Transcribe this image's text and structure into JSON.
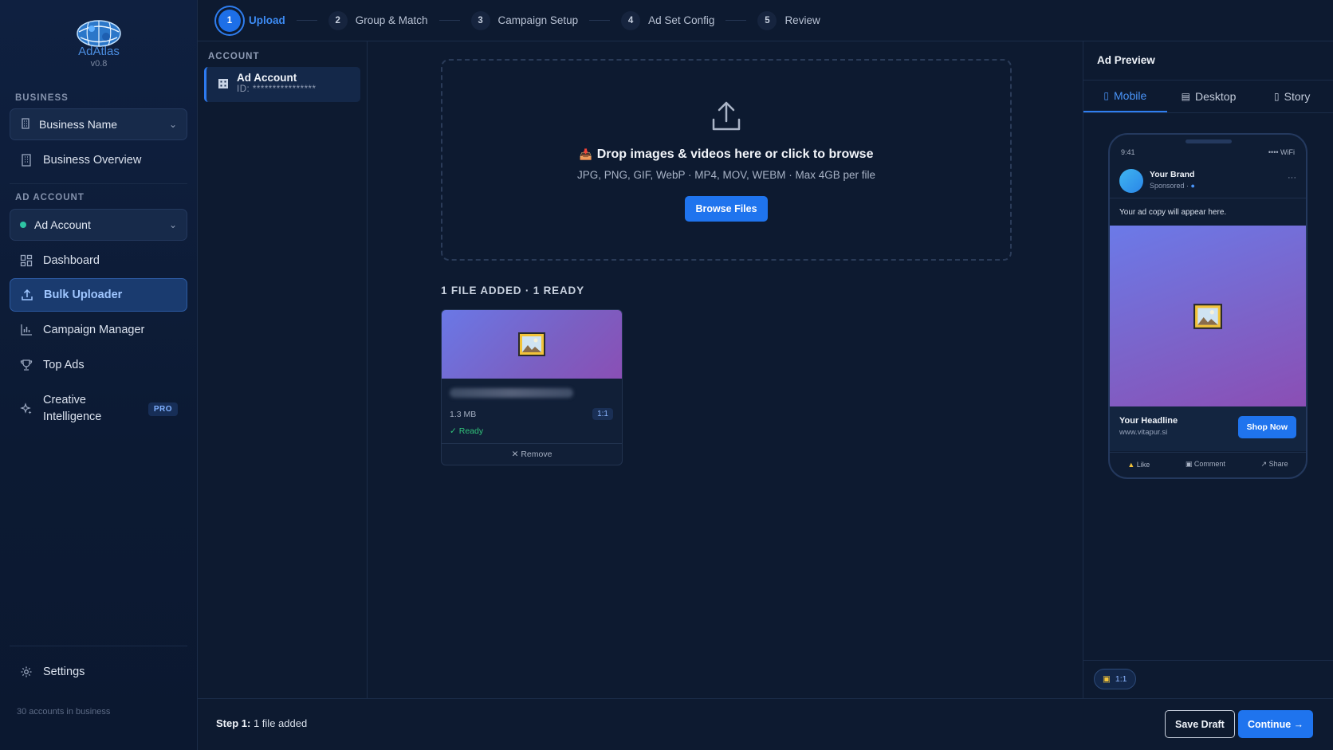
{
  "app": {
    "name": "AdAtlas",
    "version": "v0.8"
  },
  "sidebar": {
    "business_section": "BUSINESS",
    "business_select": "Business Name",
    "business_overview": "Business Overview",
    "ad_account_section": "AD ACCOUNT",
    "ad_account_select": "Ad Account",
    "nav": [
      {
        "label": "Dashboard",
        "icon": "grid-icon"
      },
      {
        "label": "Bulk Uploader",
        "icon": "upload-icon",
        "active": true
      },
      {
        "label": "Campaign Manager",
        "icon": "bar-chart-icon"
      },
      {
        "label": "Top Ads",
        "icon": "trophy-icon"
      },
      {
        "label": "Creative Intelligence",
        "icon": "sparkle-icon",
        "badge": "PRO"
      }
    ],
    "settings": "Settings",
    "footer_note": "30 accounts in business"
  },
  "stepper": [
    {
      "num": "1",
      "label": "Upload",
      "active": true
    },
    {
      "num": "2",
      "label": "Group & Match"
    },
    {
      "num": "3",
      "label": "Campaign Setup"
    },
    {
      "num": "4",
      "label": "Ad Set Config"
    },
    {
      "num": "5",
      "label": "Review"
    }
  ],
  "account_panel": {
    "heading": "ACCOUNT",
    "item_title": "Ad Account",
    "item_id": "ID: ****************"
  },
  "dropzone": {
    "title": "Drop images & videos here or click to browse",
    "subtitle": "JPG, PNG, GIF, WebP · MP4, MOV, WEBM · Max 4GB per file",
    "button": "Browse Files"
  },
  "files": {
    "heading": "1 FILE ADDED · 1 READY",
    "items": [
      {
        "size": "1.3 MB",
        "ratio": "1:1",
        "status": "Ready",
        "remove": "Remove"
      }
    ]
  },
  "preview": {
    "title": "Ad Preview",
    "tabs": [
      {
        "label": "Mobile",
        "icon": "phone-icon",
        "active": true
      },
      {
        "label": "Desktop",
        "icon": "monitor-icon"
      },
      {
        "label": "Story",
        "icon": "story-icon"
      }
    ],
    "phone": {
      "time": "9:41",
      "signal": "•••• WiFi",
      "brand": "Your Brand",
      "sponsored": "Sponsored ·",
      "more": "···",
      "copy": "Your ad copy will appear here.",
      "headline": "Your Headline",
      "url": "www.vitapur.si",
      "cta": "Shop Now",
      "actions": [
        "Like",
        "Comment",
        "Share"
      ]
    },
    "ratio": "1:1"
  },
  "footer": {
    "step_label": "Step 1:",
    "step_text": "1 file added",
    "save": "Save Draft",
    "continue": "Continue →"
  },
  "colors": {
    "accent": "#1f74ee",
    "background": "#0d1a30",
    "ready_green": "#31c47a"
  }
}
